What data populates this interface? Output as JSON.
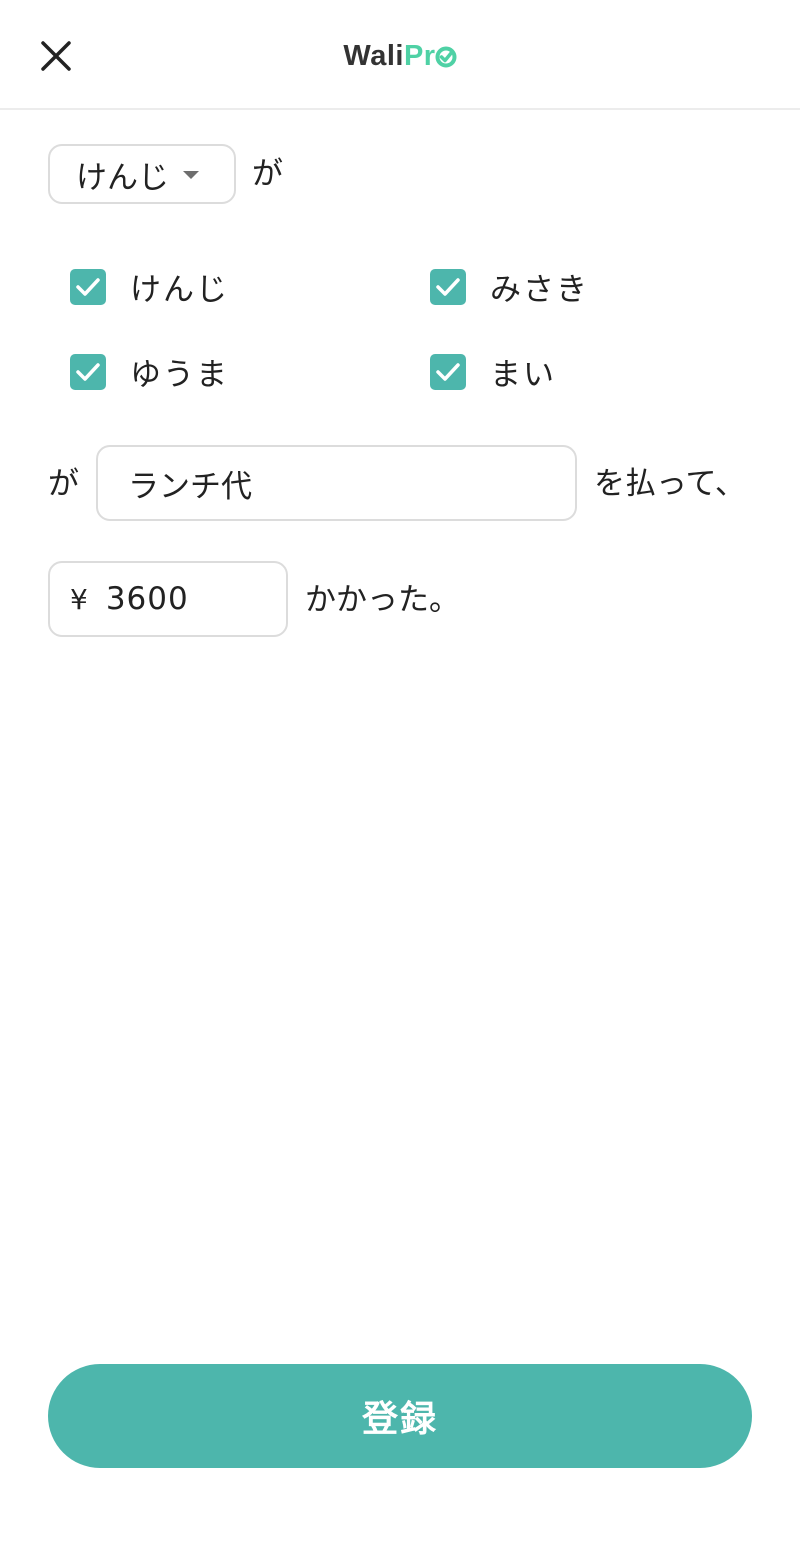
{
  "header": {
    "logo_part1": "Wali",
    "logo_part2": "Pr",
    "close_icon": "close-icon"
  },
  "form": {
    "payer": {
      "selected": "けんじ",
      "suffix": "が"
    },
    "participants": [
      {
        "name": "けんじ",
        "checked": true
      },
      {
        "name": "みさき",
        "checked": true
      },
      {
        "name": "ゆうま",
        "checked": true
      },
      {
        "name": "まい",
        "checked": true
      }
    ],
    "for_prefix": "が",
    "purpose": {
      "value": "ランチ代"
    },
    "for_suffix": "を払って、",
    "amount": {
      "currency": "¥",
      "value": "3600"
    },
    "amount_suffix": "かかった。"
  },
  "submit": {
    "label": "登録"
  },
  "colors": {
    "accent": "#4db6ac",
    "logo_accent": "#4fd1a5",
    "border": "#dcdcdc"
  }
}
